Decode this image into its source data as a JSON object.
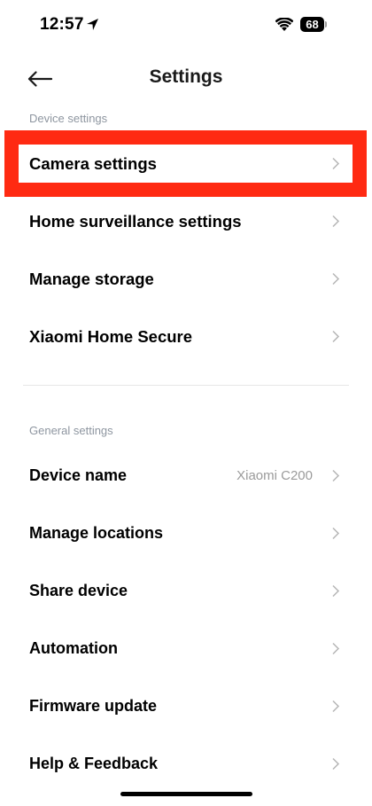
{
  "status_bar": {
    "time": "12:57",
    "battery": "68",
    "icons": [
      "location-arrow-icon",
      "wifi-icon",
      "battery-icon"
    ]
  },
  "header": {
    "title": "Settings",
    "back_icon": "arrow-left-icon"
  },
  "device_settings": {
    "header": "Device settings",
    "items": [
      {
        "label": "Camera settings",
        "highlighted": true
      },
      {
        "label": "Home surveillance settings"
      },
      {
        "label": "Manage storage"
      },
      {
        "label": "Xiaomi Home Secure"
      }
    ]
  },
  "general_settings": {
    "header": "General settings",
    "items": [
      {
        "label": "Device name",
        "value": "Xiaomi C200"
      },
      {
        "label": "Manage locations"
      },
      {
        "label": "Share device"
      },
      {
        "label": "Automation"
      },
      {
        "label": "Firmware update"
      },
      {
        "label": "Help & Feedback"
      }
    ]
  },
  "colors": {
    "highlight": "#ff2a12",
    "section_header": "#8e96a0",
    "value_text": "#9b9b9b",
    "chevron": "#b5b5b5"
  }
}
